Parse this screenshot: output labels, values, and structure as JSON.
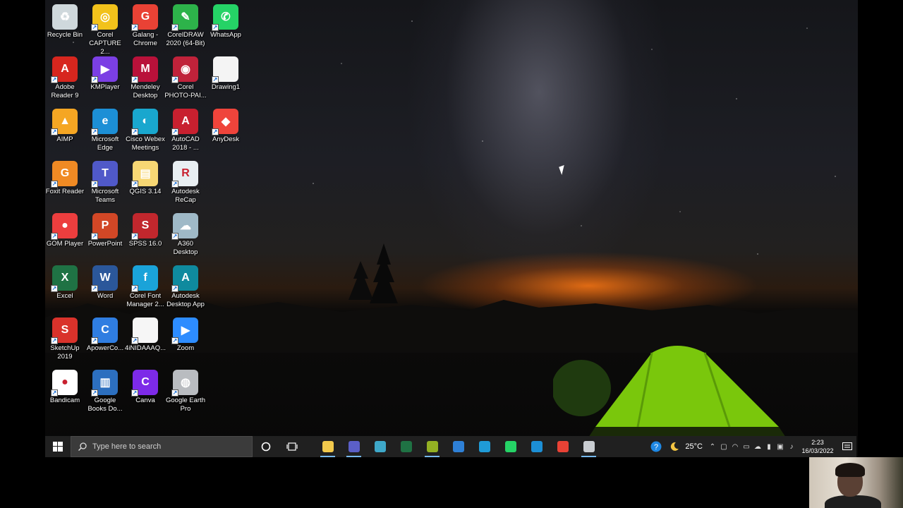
{
  "desktop": {
    "icons": [
      {
        "label": "Recycle Bin",
        "icon": "recycle-bin-icon",
        "color": "#cfd8dc",
        "glyph": "♻"
      },
      {
        "label": "Corel\nCAPTURE 2...",
        "icon": "corel-capture-icon",
        "color": "#f2c21b",
        "glyph": "◎"
      },
      {
        "label": "Galang -\nChrome",
        "icon": "chrome-icon",
        "color": "#e94235",
        "glyph": "G"
      },
      {
        "label": "CorelDRAW\n2020 (64-Bit)",
        "icon": "coreldraw-icon",
        "color": "#2db34a",
        "glyph": "✎"
      },
      {
        "label": "WhatsApp",
        "icon": "whatsapp-icon",
        "color": "#25d366",
        "glyph": "✆"
      },
      {
        "label": "Adobe\nReader 9",
        "icon": "adobe-reader-icon",
        "color": "#d7261e",
        "glyph": "A"
      },
      {
        "label": "KMPlayer",
        "icon": "kmplayer-icon",
        "color": "#7b3fe4",
        "glyph": "▶"
      },
      {
        "label": "Mendeley\nDesktop",
        "icon": "mendeley-icon",
        "color": "#b9113a",
        "glyph": "M"
      },
      {
        "label": "Corel\nPHOTO-PAI...",
        "icon": "corel-photopaint-icon",
        "color": "#c0223a",
        "glyph": "◉"
      },
      {
        "label": "Drawing1",
        "icon": "drawing-file-icon",
        "color": "#f4f4f4",
        "glyph": ""
      },
      {
        "label": "AIMP",
        "icon": "aimp-icon",
        "color": "#f5a623",
        "glyph": "▲"
      },
      {
        "label": "Microsoft\nEdge",
        "icon": "edge-icon",
        "color": "#1c8fd6",
        "glyph": "e"
      },
      {
        "label": "Cisco Webex\nMeetings",
        "icon": "webex-icon",
        "color": "#19a7ce",
        "glyph": "◐"
      },
      {
        "label": "AutoCAD\n2018 - ...",
        "icon": "autocad-icon",
        "color": "#c8202f",
        "glyph": "A"
      },
      {
        "label": "AnyDesk",
        "icon": "anydesk-icon",
        "color": "#ef443b",
        "glyph": "◆"
      },
      {
        "label": "Foxit Reader",
        "icon": "foxit-reader-icon",
        "color": "#f08a24",
        "glyph": "G"
      },
      {
        "label": "Microsoft\nTeams",
        "icon": "teams-icon",
        "color": "#5059c9",
        "glyph": "T"
      },
      {
        "label": "QGIS 3.14",
        "icon": "qgis-folder-icon",
        "color": "#f7d774",
        "glyph": "▤"
      },
      {
        "label": "Autodesk\nReCap",
        "icon": "recap-icon",
        "color": "#e8eef2",
        "glyph": "R"
      },
      {
        "label": "",
        "icon": "empty-slot",
        "color": "transparent",
        "glyph": ""
      },
      {
        "label": "GOM Player",
        "icon": "gom-player-icon",
        "color": "#ec3e3e",
        "glyph": "●"
      },
      {
        "label": "PowerPoint",
        "icon": "powerpoint-icon",
        "color": "#d24726",
        "glyph": "P"
      },
      {
        "label": "SPSS 16.0",
        "icon": "spss-icon",
        "color": "#c1272d",
        "glyph": "S"
      },
      {
        "label": "A360\nDesktop",
        "icon": "a360-icon",
        "color": "#9fb9c7",
        "glyph": "☁"
      },
      {
        "label": "",
        "icon": "empty-slot",
        "color": "transparent",
        "glyph": ""
      },
      {
        "label": "Excel",
        "icon": "excel-icon",
        "color": "#1f7244",
        "glyph": "X"
      },
      {
        "label": "Word",
        "icon": "word-icon",
        "color": "#2b579a",
        "glyph": "W"
      },
      {
        "label": "Corel Font\nManager 2...",
        "icon": "corel-font-manager-icon",
        "color": "#1aa3d9",
        "glyph": "f"
      },
      {
        "label": "Autodesk\nDesktop App",
        "icon": "autodesk-desktop-app-icon",
        "color": "#0f8a9e",
        "glyph": "A"
      },
      {
        "label": "",
        "icon": "empty-slot",
        "color": "transparent",
        "glyph": ""
      },
      {
        "label": "SketchUp\n2019",
        "icon": "sketchup-icon",
        "color": "#d9322b",
        "glyph": "S"
      },
      {
        "label": "ApowerCo...",
        "icon": "apowerrec-icon",
        "color": "#2f7de1",
        "glyph": "C"
      },
      {
        "label": "4iNIDAAAQ...",
        "icon": "image-file-icon",
        "color": "#f6f6f6",
        "glyph": ""
      },
      {
        "label": "Zoom",
        "icon": "zoom-icon",
        "color": "#2d8cff",
        "glyph": "▶"
      },
      {
        "label": "",
        "icon": "empty-slot",
        "color": "transparent",
        "glyph": ""
      },
      {
        "label": "Bandicam",
        "icon": "bandicam-icon",
        "color": "#ffffff",
        "glyph": "●"
      },
      {
        "label": "Google\nBooks Do...",
        "icon": "google-books-icon",
        "color": "#2c6fbf",
        "glyph": "▥"
      },
      {
        "label": "Canva",
        "icon": "canva-icon",
        "color": "#7d2ae8",
        "glyph": "C"
      },
      {
        "label": "Google Earth\nPro",
        "icon": "google-earth-pro-icon",
        "color": "#b9bcc0",
        "glyph": "◍"
      }
    ]
  },
  "taskbar": {
    "search_placeholder": "Type here to search",
    "apps": [
      {
        "name": "file-explorer-taskbar-icon",
        "color": "#f2c94c",
        "active": true
      },
      {
        "name": "teams-taskbar-icon",
        "color": "#5b5fc7",
        "active": true
      },
      {
        "name": "qgis-browser-taskbar-icon",
        "color": "#3ea8c9",
        "active": false
      },
      {
        "name": "excel-taskbar-icon",
        "color": "#1f7244",
        "active": false
      },
      {
        "name": "qgis-taskbar-icon",
        "color": "#93b023",
        "active": true
      },
      {
        "name": "photos-taskbar-icon",
        "color": "#2e80d6",
        "active": false
      },
      {
        "name": "internet-explorer-taskbar-icon",
        "color": "#1f9bd7",
        "active": false
      },
      {
        "name": "whatsapp-taskbar-icon",
        "color": "#25d366",
        "active": false
      },
      {
        "name": "edge-taskbar-icon",
        "color": "#1c8fd6",
        "active": false
      },
      {
        "name": "chrome-taskbar-icon",
        "color": "#e94235",
        "active": false
      },
      {
        "name": "google-earth-taskbar-icon",
        "color": "#c9cdd1",
        "active": true
      }
    ],
    "tray": {
      "temperature": "25°C",
      "time": "2:23",
      "date": "16/03/2022"
    }
  }
}
